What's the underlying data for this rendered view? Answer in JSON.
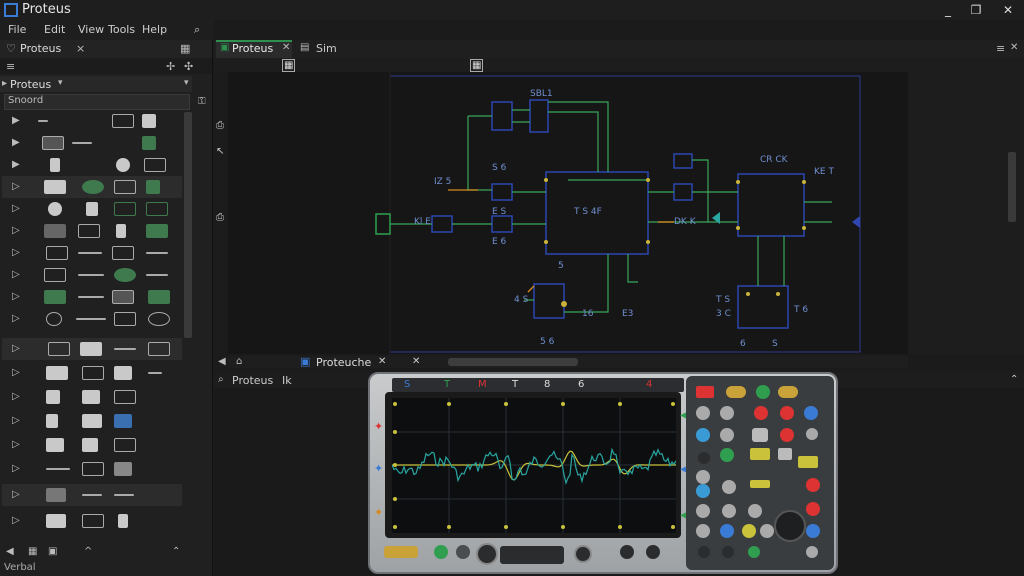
{
  "window": {
    "title": "Proteus",
    "controls": [
      "_",
      "❐",
      "✕"
    ]
  },
  "menu": {
    "items": [
      "File",
      "Edit",
      "View",
      "Tools",
      "Help"
    ]
  },
  "left_panel": {
    "tab_label": "Proteus",
    "project_label": "Proteus",
    "search_text": "Snoord",
    "status_text": "Verbal"
  },
  "editor": {
    "tab_active": "Proteus",
    "tab_other": "Sim",
    "bottom_tab": "Proteuche",
    "lower_tab": "Proteus",
    "lower_tab_aux": "Ik"
  },
  "schematic": {
    "labels": [
      "SBL1",
      "S 6",
      "E 6",
      "Kl E",
      "IZ 5",
      "T S 4F",
      "E S",
      "DK K",
      "CR CK",
      "T S",
      "KE T",
      "3 C",
      "T 6",
      "6",
      "5",
      "5 6",
      "16",
      "E3",
      "S",
      "4 S"
    ]
  },
  "scope": {
    "top_labels": [
      "S",
      "T",
      "M",
      "T",
      "8",
      "6",
      "4"
    ],
    "trace_color": "#2aa6a0",
    "trace2_color": "#c9c23a"
  }
}
